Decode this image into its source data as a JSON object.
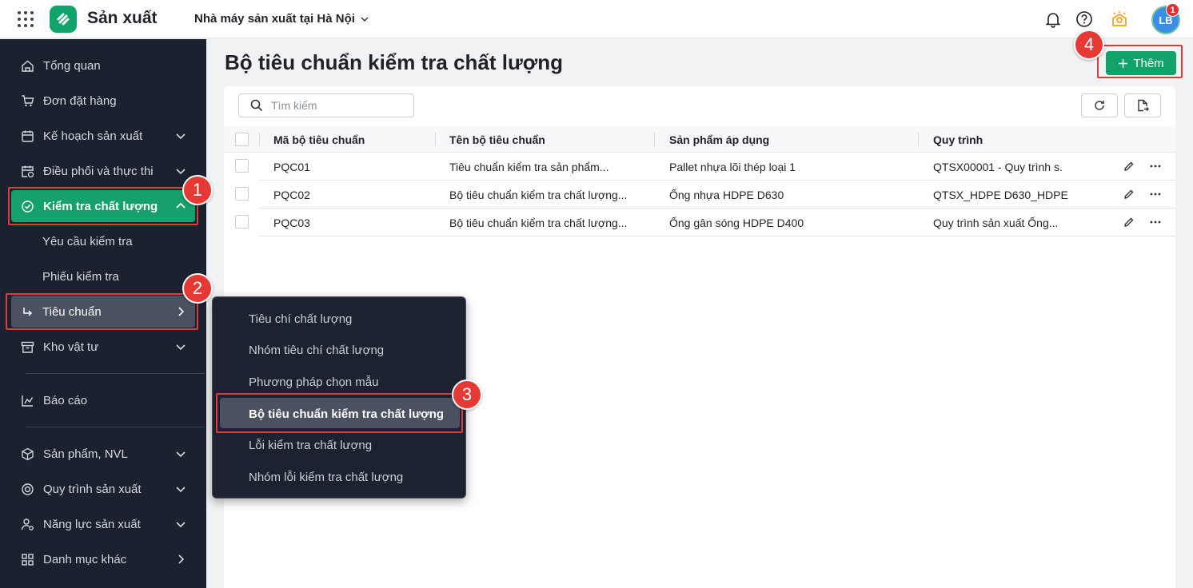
{
  "header": {
    "app_title": "Sản xuất",
    "factory_name": "Nhà máy sản xuất tại Hà Nội",
    "avatar_initials": "LB",
    "notification_count": "1"
  },
  "sidebar": {
    "items": [
      {
        "label": "Tổng quan",
        "icon": "home-icon"
      },
      {
        "label": "Đơn đặt hàng",
        "icon": "cart-icon"
      },
      {
        "label": "Kế hoạch sản xuất",
        "icon": "calendar-icon"
      },
      {
        "label": "Điều phối và thực thi",
        "icon": "calendar-clock-icon"
      },
      {
        "label": "Kiểm tra chất lượng",
        "icon": "check-circle-icon"
      },
      {
        "label": "Yêu cầu kiểm tra"
      },
      {
        "label": "Phiếu kiểm tra"
      },
      {
        "label": "Tiêu chuẩn",
        "icon": "arrow-return-icon"
      },
      {
        "label": "Kho vật tư",
        "icon": "archive-icon"
      },
      {
        "label": "Báo cáo",
        "icon": "chart-icon"
      },
      {
        "label": "Sản phẩm, NVL",
        "icon": "box-icon"
      },
      {
        "label": "Quy trình sản xuất",
        "icon": "process-icon"
      },
      {
        "label": "Năng lực sản xuất",
        "icon": "user-gear-icon"
      },
      {
        "label": "Danh mục khác",
        "icon": "apps-icon"
      }
    ]
  },
  "flyout": {
    "items": [
      "Tiêu chí chất lượng",
      "Nhóm tiêu chí chất lượng",
      "Phương pháp chọn mẫu",
      "Bộ tiêu chuẩn kiểm tra chất lượng",
      "Lỗi kiểm tra chất lượng",
      "Nhóm lỗi kiểm tra chất lượng"
    ]
  },
  "main": {
    "title": "Bộ tiêu chuẩn kiểm tra chất lượng",
    "add_label": "Thêm",
    "search_placeholder": "Tìm kiếm"
  },
  "table": {
    "columns": [
      "Mã bộ tiêu chuẩn",
      "Tên bộ tiêu chuẩn",
      "Sản phẩm áp dụng",
      "Quy trình"
    ],
    "rows": [
      [
        "PQC01",
        "Tiêu chuẩn kiểm tra sản phẩm...",
        "Pallet nhựa lõi thép loại 1",
        "QTSX00001 - Quy trình s."
      ],
      [
        "PQC02",
        "Bộ tiêu chuẩn kiểm tra chất lượng...",
        "Ống nhựa HDPE D630",
        "QTSX_HDPE D630_HDPE"
      ],
      [
        "PQC03",
        "Bộ tiêu chuẩn kiểm tra chất lượng...",
        "Ống gân sóng HDPE D400",
        "Quy trình sản xuất Ống..."
      ]
    ]
  },
  "steps": [
    "1",
    "2",
    "3",
    "4"
  ],
  "colors": {
    "accent": "#12a36b",
    "sidebar": "#1a2230",
    "highlight": "#e03a3a"
  }
}
